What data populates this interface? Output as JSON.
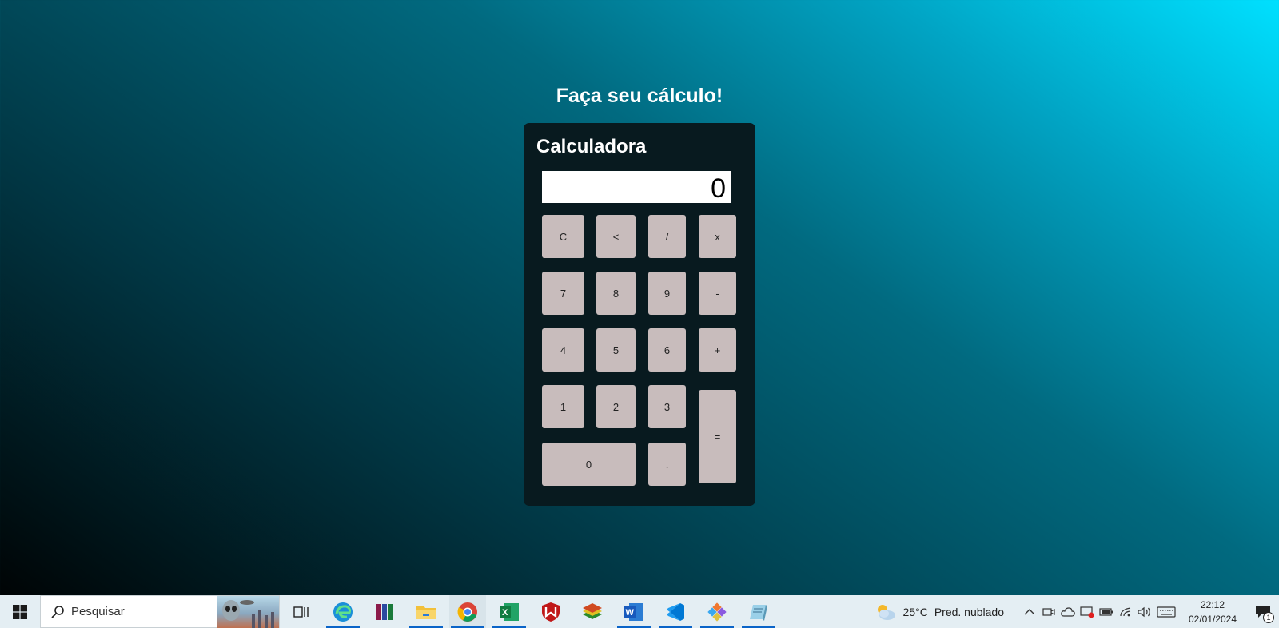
{
  "page": {
    "title": "Faça seu cálculo!"
  },
  "calculator": {
    "title": "Calculadora",
    "display": "0",
    "keys": {
      "clear": "C",
      "backspace": "<",
      "divide": "/",
      "multiply": "x",
      "seven": "7",
      "eight": "8",
      "nine": "9",
      "minus": "-",
      "four": "4",
      "five": "5",
      "six": "6",
      "plus": "+",
      "one": "1",
      "two": "2",
      "three": "3",
      "equals": "=",
      "zero": "0",
      "decimal": "."
    }
  },
  "taskbar": {
    "search_placeholder": "Pesquisar",
    "weather": {
      "temp": "25°C",
      "condition": "Pred. nublado"
    },
    "clock": {
      "time": "22:12",
      "date": "02/01/2024"
    },
    "notifications_count": "1",
    "apps": [
      "task-view",
      "edge",
      "winrar",
      "file-explorer",
      "chrome",
      "excel",
      "mcafee",
      "bluestacks",
      "word",
      "vscode",
      "snipping-tool",
      "notepad"
    ]
  }
}
